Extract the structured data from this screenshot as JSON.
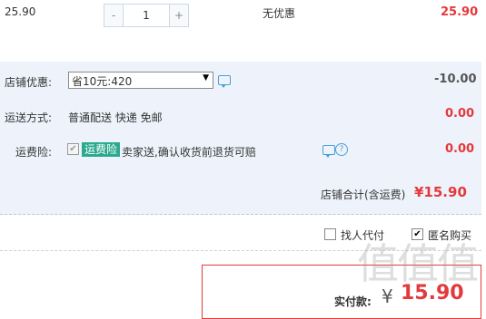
{
  "item": {
    "price": "25.90",
    "qty_minus": "-",
    "quantity": "1",
    "qty_plus": "+",
    "discount_status": "无优惠",
    "total": "25.90"
  },
  "store_discount": {
    "label": "店铺优惠:",
    "selected": "省10元:420",
    "amount": "-10.00"
  },
  "shipping": {
    "label": "运送方式:",
    "method": "普通配送 快递 免邮",
    "amount": "0.00"
  },
  "insurance": {
    "label": "运费险:",
    "badge": "运费险",
    "description": "卖家送,确认收货前退货可赔",
    "help": "?",
    "amount": "0.00"
  },
  "store_total": {
    "label": "店铺合计(含运费)",
    "amount": "¥15.90"
  },
  "options": {
    "pay_for_me": "找人代付",
    "anonymous": "匿名购买",
    "anonymous_checked": "✔"
  },
  "payment": {
    "label": "实付款:",
    "currency": "¥",
    "amount": "15.90"
  },
  "watermark": "值值值",
  "colors": {
    "accent_red": "#e4393c",
    "panel_blue": "#eef3fb",
    "badge_green": "#2ba98f"
  }
}
